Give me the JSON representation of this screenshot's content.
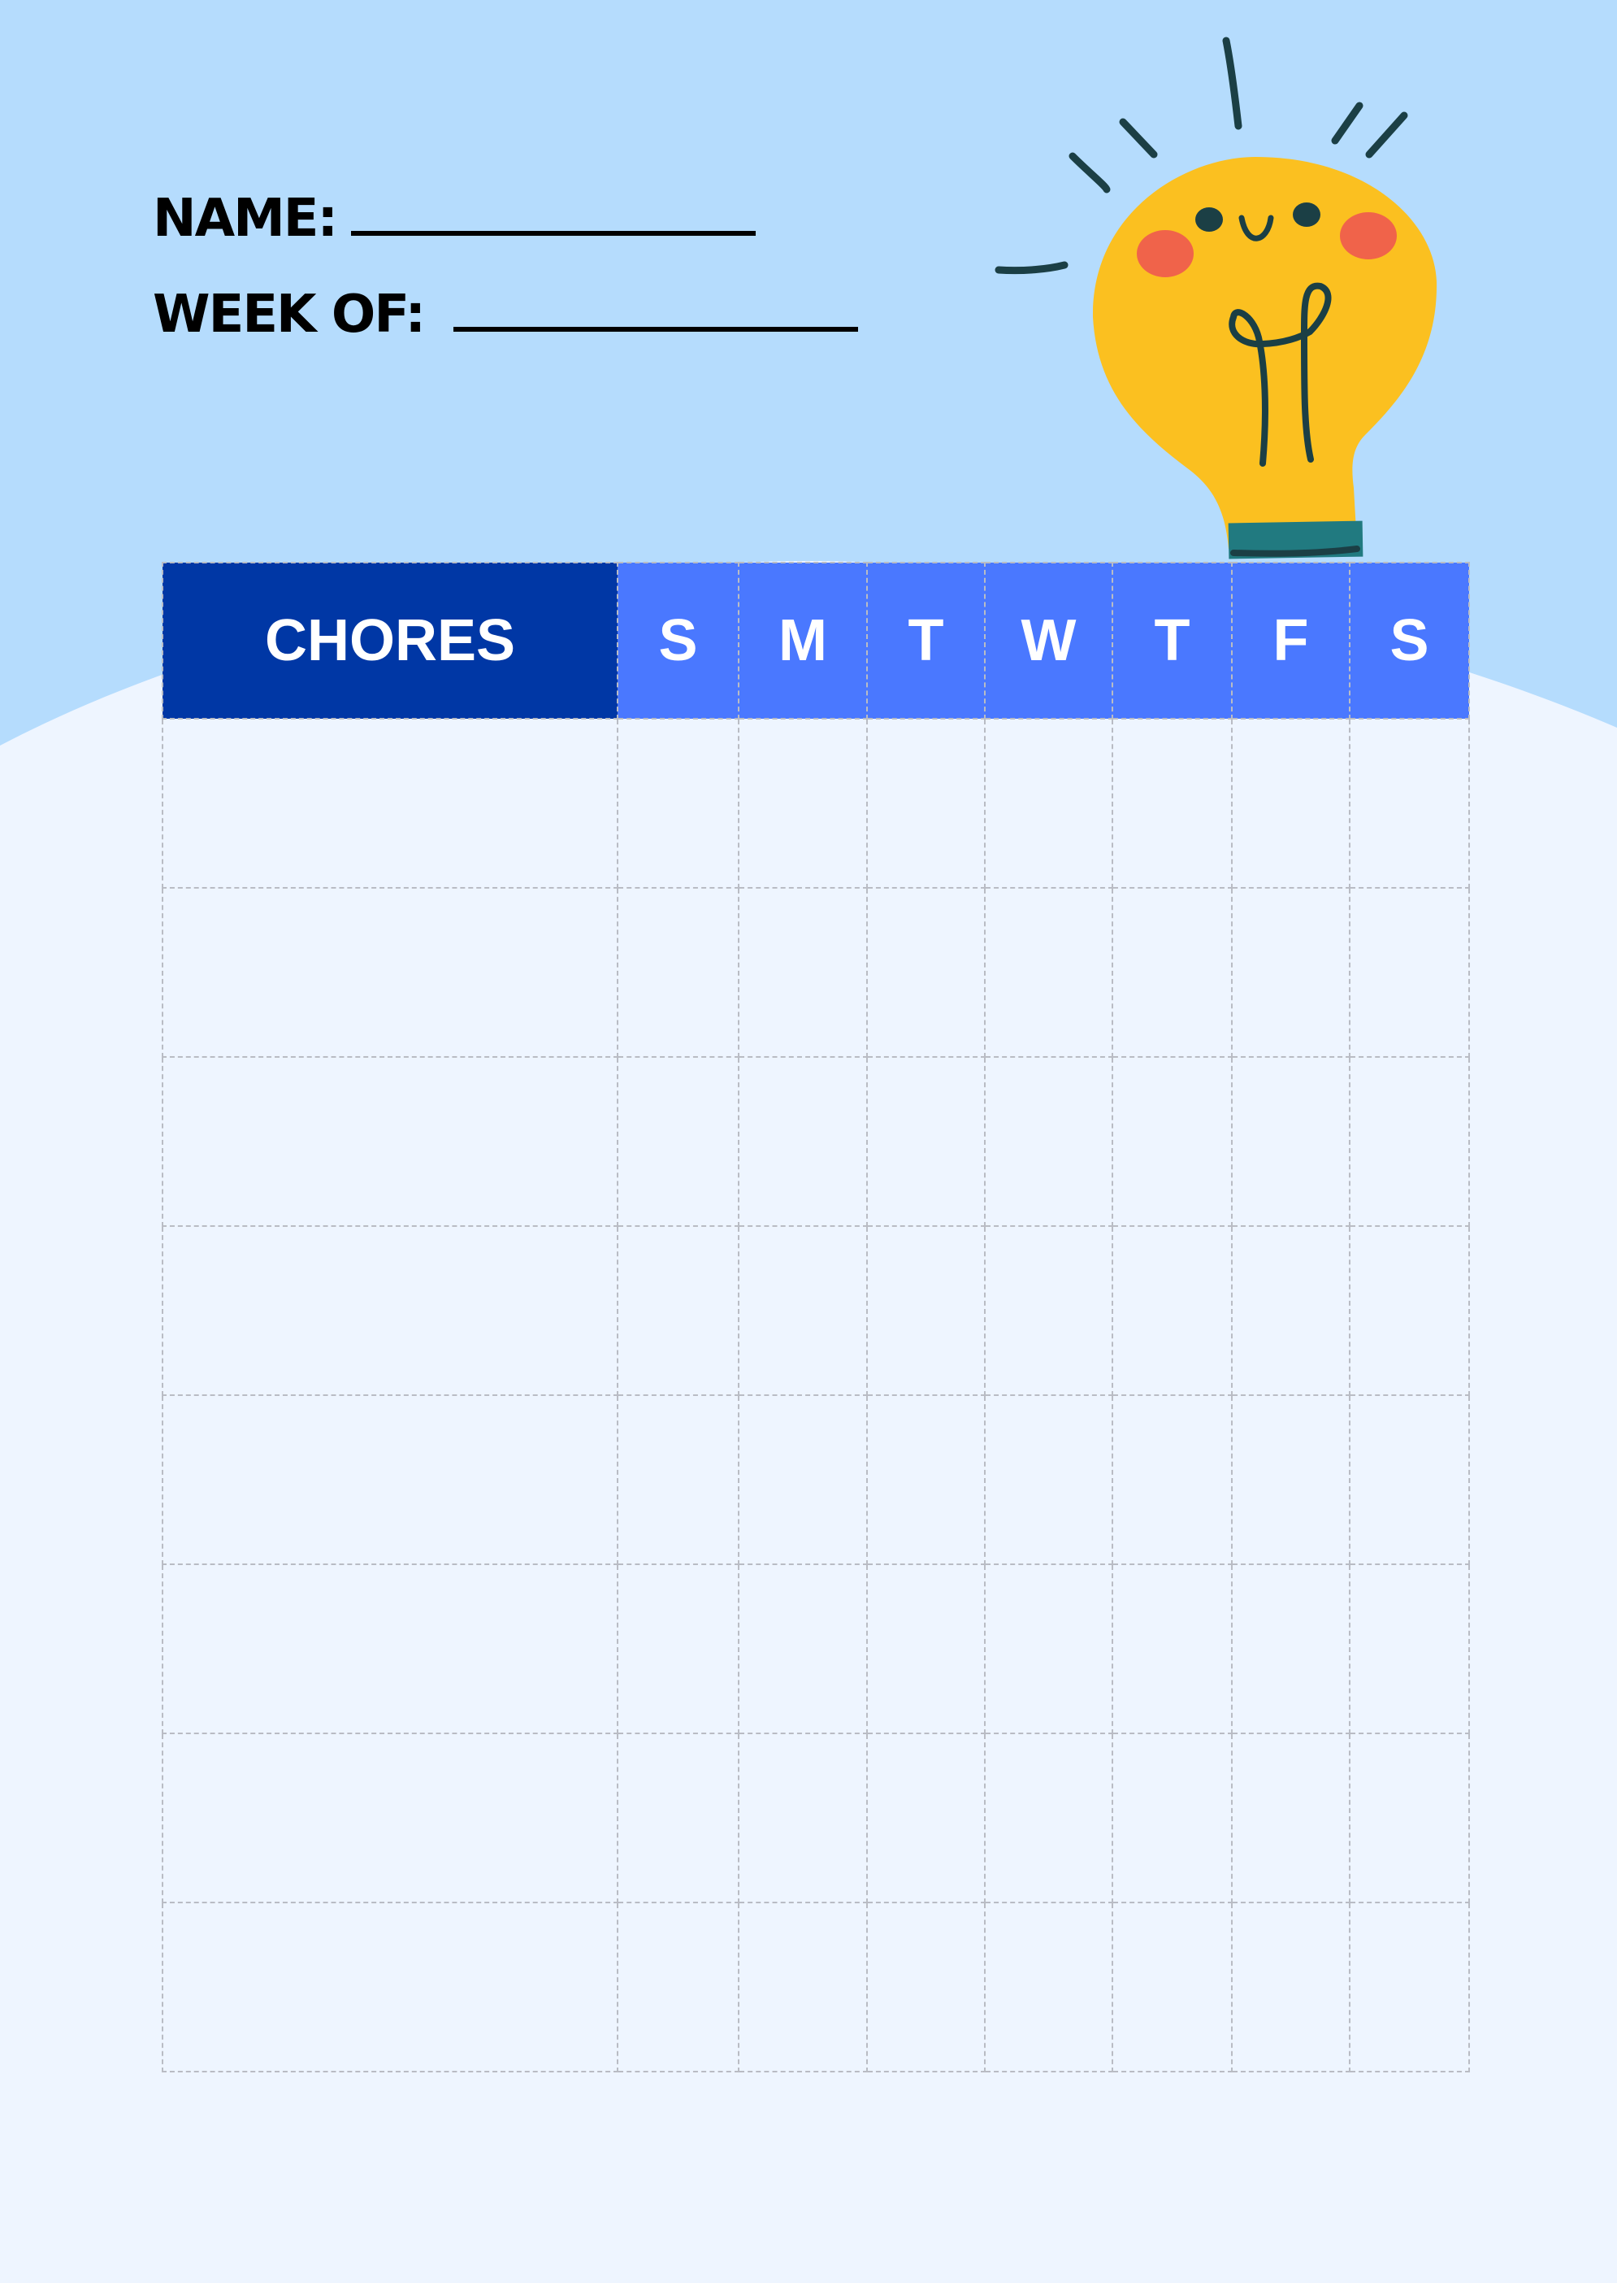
{
  "form": {
    "name_label": "NAME:",
    "week_label": "WEEK OF:"
  },
  "colors": {
    "sky": "#B5DCFD",
    "page": "#EEF5FF",
    "chores_header": "#0037A5",
    "day_header": "#4A78FF",
    "grid": "#B9BCC4",
    "bulb": "#FBC020",
    "cheek": "#F0634A",
    "ink": "#1B3F45",
    "socket": "#217A80"
  },
  "illustration": {
    "icon": "smiling-lightbulb-icon"
  },
  "table": {
    "chores_header": "CHORES",
    "days": [
      "S",
      "M",
      "T",
      "W",
      "T",
      "F",
      "S"
    ],
    "row_count": 8
  }
}
